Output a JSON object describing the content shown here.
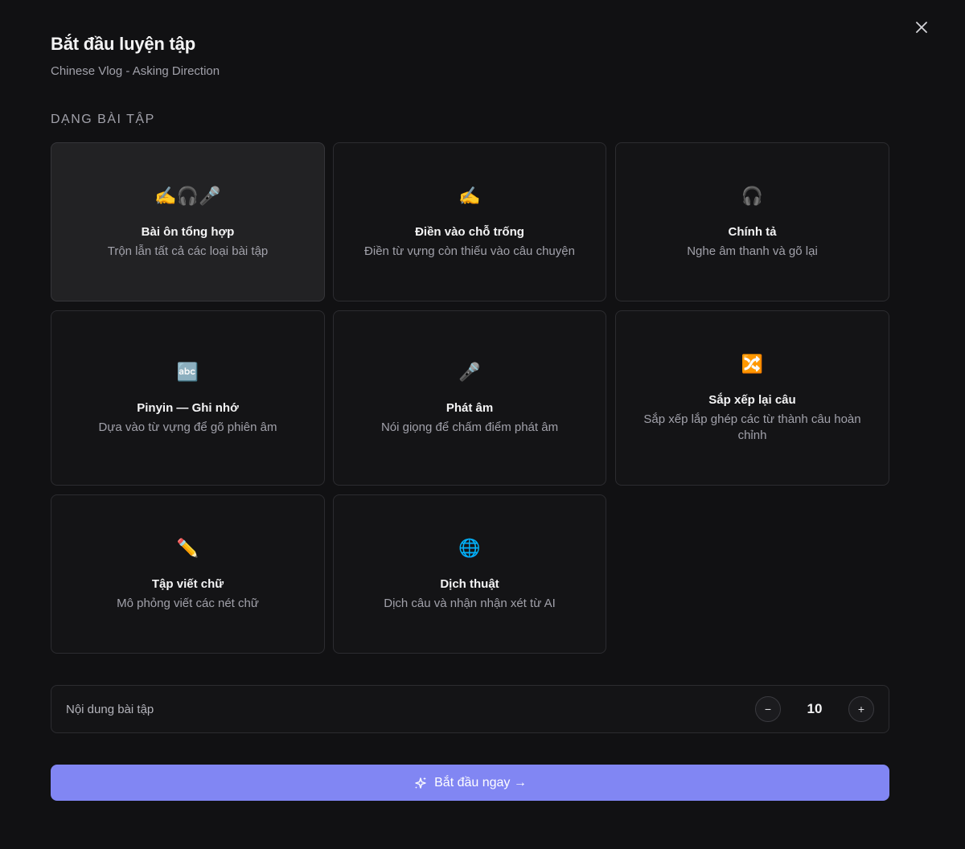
{
  "modal": {
    "title": "Bắt đầu luyện tập",
    "subtitle": "Chinese Vlog - Asking Direction",
    "close_icon": "close-icon"
  },
  "section": {
    "label": "DẠNG BÀI TẬP"
  },
  "exercises": [
    {
      "icon": "✍️🎧🎤",
      "icon_name": "mixed-review-icon",
      "title": "Bài ôn tổng hợp",
      "desc": "Trộn lẫn tất cả các loại bài tập",
      "selected": true
    },
    {
      "icon": "✍️",
      "icon_name": "writing-hand-icon",
      "title": "Điền vào chỗ trống",
      "desc": "Điền từ vựng còn thiếu vào câu chuyện",
      "selected": false
    },
    {
      "icon": "🎧",
      "icon_name": "headphones-icon",
      "title": "Chính tả",
      "desc": "Nghe âm thanh và gõ lại",
      "selected": false
    },
    {
      "icon": "🔤",
      "icon_name": "abc-icon",
      "title": "Pinyin — Ghi nhớ",
      "desc": "Dựa vào từ vựng để gõ phiên âm",
      "selected": false
    },
    {
      "icon": "🎤",
      "icon_name": "microphone-icon",
      "title": "Phát âm",
      "desc": "Nói giọng để chấm điểm phát âm",
      "selected": false
    },
    {
      "icon": "🔀",
      "icon_name": "shuffle-icon",
      "title": "Sắp xếp lại câu",
      "desc": "Sắp xếp lắp ghép các từ thành câu hoàn chỉnh",
      "selected": false
    },
    {
      "icon": "✏️",
      "icon_name": "pencil-icon",
      "title": "Tập viết chữ",
      "desc": "Mô phỏng viết các nét chữ",
      "selected": false
    },
    {
      "icon": "🌐",
      "icon_name": "globe-icon",
      "title": "Dịch thuật",
      "desc": "Dịch câu và nhận nhận xét từ AI",
      "selected": false
    }
  ],
  "content": {
    "label": "Nội dung bài tập",
    "minus": "−",
    "value": "10",
    "plus": "+"
  },
  "start_button": {
    "label": "Bắt đầu ngay →",
    "icon": "sparkles-icon"
  },
  "colors": {
    "background": "#111113",
    "card_border": "#2c2c30",
    "selected_card": "#222224",
    "primary": "#8186f3"
  }
}
